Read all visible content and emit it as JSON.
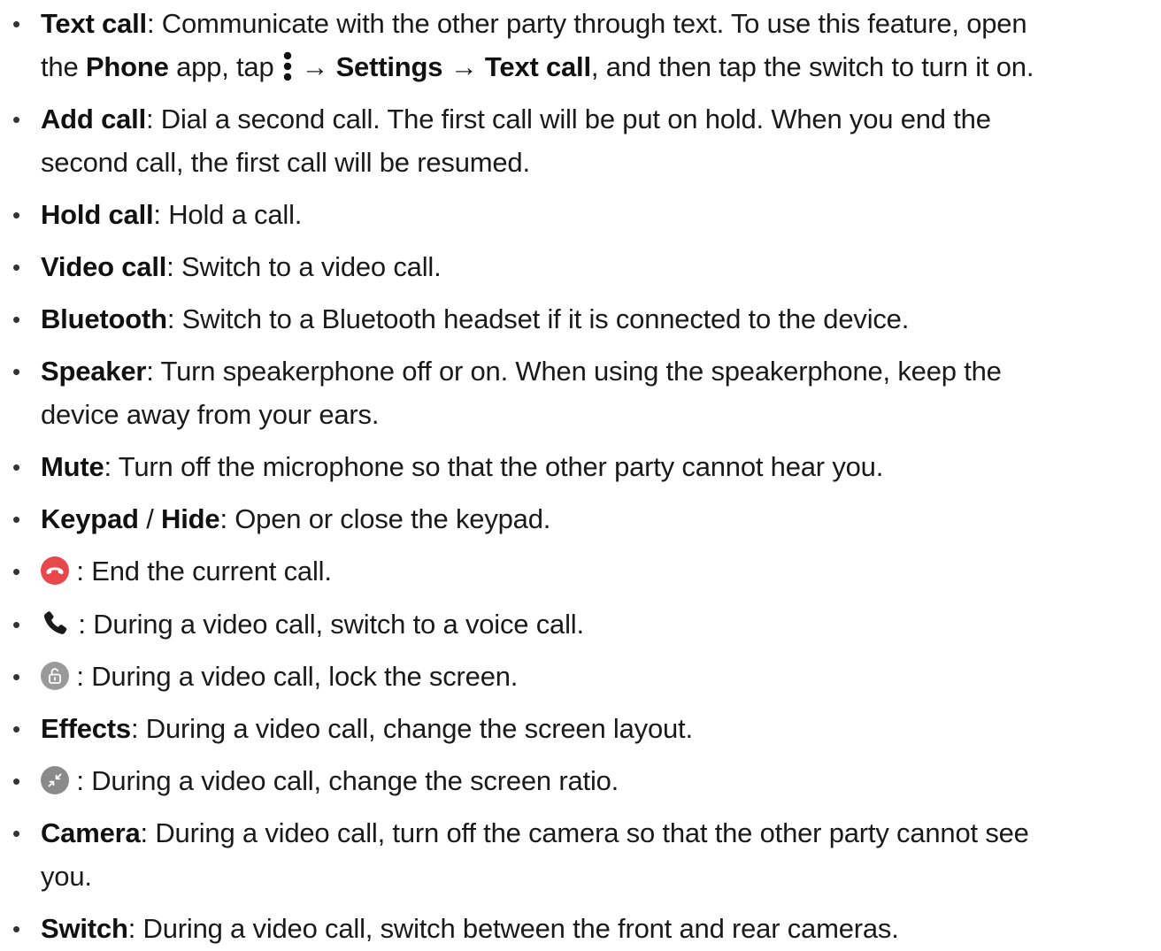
{
  "items": [
    {
      "term": "Text call",
      "line1": ": Communicate with the other party through text. To use this feature, open",
      "line2_prefix": "the ",
      "app_name": "Phone",
      "app_suffix": " app, tap ",
      "arrow1": " → ",
      "settings": "Settings",
      "arrow2": " → ",
      "text_call": "Text call",
      "line2_end": ", and then tap the switch to turn it on."
    },
    {
      "term": "Add call",
      "line1": ": Dial a second call. The first call will be put on hold. When you end the",
      "line2": "second call, the first call will be resumed."
    },
    {
      "term": "Hold call",
      "text": ": Hold a call."
    },
    {
      "term": "Video call",
      "text": ": Switch to a video call."
    },
    {
      "term": "Bluetooth",
      "text": ": Switch to a Bluetooth headset if it is connected to the device."
    },
    {
      "term": "Speaker",
      "line1": ": Turn speakerphone off or on. When using the speakerphone, keep the",
      "line2": "device away from your ears."
    },
    {
      "term": "Mute",
      "text": ": Turn off the microphone so that the other party cannot hear you."
    },
    {
      "term": "Keypad",
      "sep": " / ",
      "term2": "Hide",
      "text": ": Open or close the keypad."
    },
    {
      "icon": "end-call-icon",
      "text": " : End the current call."
    },
    {
      "icon": "voice-call-icon",
      "text": " : During a video call, switch to a voice call."
    },
    {
      "icon": "lock-screen-icon",
      "text": " : During a video call, lock the screen."
    },
    {
      "term": "Effects",
      "text": ": During a video call, change the screen layout."
    },
    {
      "icon": "screen-ratio-icon",
      "text": " : During a video call, change the screen ratio."
    },
    {
      "term": "Camera",
      "line1": ": During a video call, turn off the camera so that the other party cannot see",
      "line2": "you."
    },
    {
      "term": "Switch",
      "text": ": During a video call, switch between the front and rear cameras."
    }
  ],
  "bullet": "•",
  "colors": {
    "end_call": "#e8474b",
    "voice_call": "#1a1a1a",
    "lock_bg": "#9a9a9a",
    "ratio_bg": "#8a8a8a"
  }
}
